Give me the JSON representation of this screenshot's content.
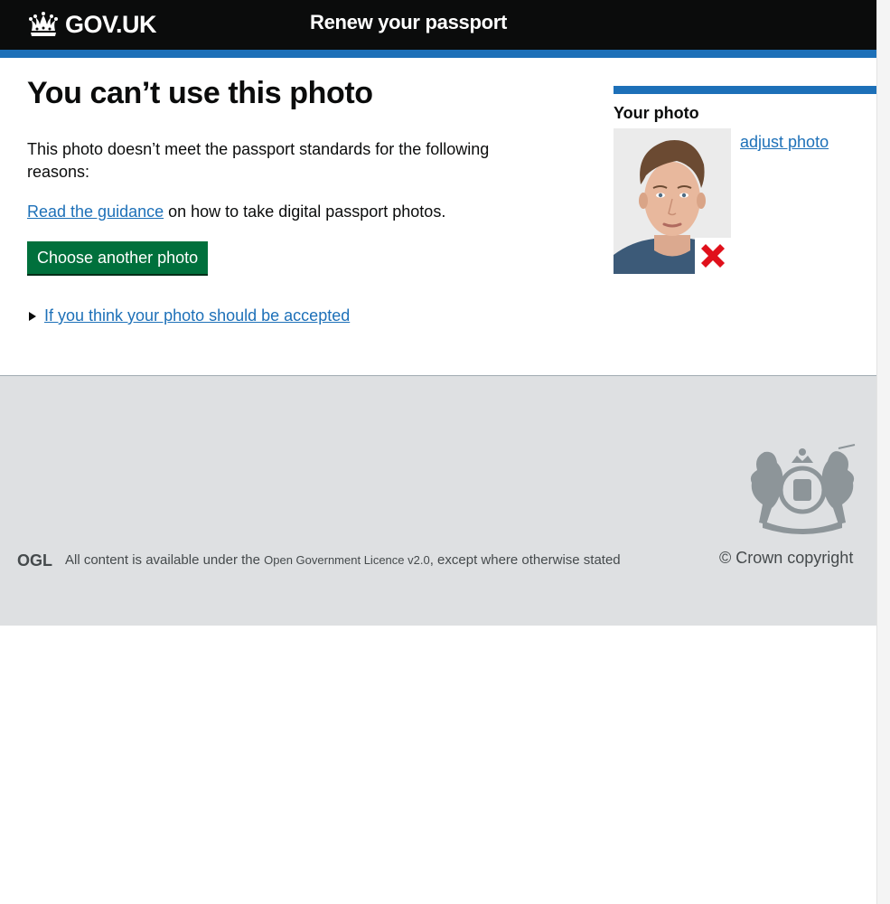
{
  "header": {
    "logo_text": "GOV.UK",
    "service_name": "Renew your passport"
  },
  "main": {
    "heading": "You can’t use this photo",
    "reason_text": "This photo doesn’t meet the passport standards for the following reasons:",
    "guidance_link": "Read the guidance",
    "guidance_suffix": " on how to take digital passport photos.",
    "button_label": "Choose another photo",
    "details_summary": "If you think your photo should be accepted"
  },
  "sidebar": {
    "title": "Your photo",
    "adjust_link": "adjust photo"
  },
  "footer": {
    "licence_prefix": "All content is available under the ",
    "licence_link": "Open Government Licence v2.0",
    "licence_suffix": ", except where otherwise stated",
    "copyright": "© Crown copyright",
    "ogl_logo_text": "OGL"
  },
  "colors": {
    "header_bg": "#0b0c0c",
    "brand_blue": "#1d70b8",
    "button_green": "#00703c",
    "reject_red": "#e0101b",
    "footer_bg": "#dee0e2"
  }
}
